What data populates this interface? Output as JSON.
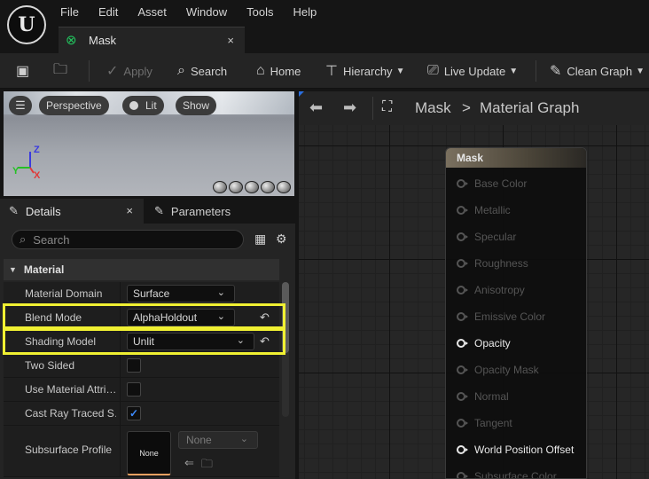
{
  "menu": [
    "File",
    "Edit",
    "Asset",
    "Window",
    "Tools",
    "Help"
  ],
  "tab": {
    "label": "Mask",
    "close": "×"
  },
  "toolbar": {
    "apply": "Apply",
    "search": "Search",
    "home": "Home",
    "hierarchy": "Hierarchy",
    "live_update": "Live Update",
    "clean_graph": "Clean Graph"
  },
  "viewport": {
    "perspective": "Perspective",
    "lit": "Lit",
    "show": "Show",
    "axis_z": "Z",
    "axis_y": "Y",
    "axis_x": "X"
  },
  "panel_tabs": {
    "details": "Details",
    "details_close": "×",
    "parameters": "Parameters"
  },
  "details": {
    "search_placeholder": "Search",
    "section": "Material",
    "rows": {
      "material_domain": {
        "label": "Material Domain",
        "value": "Surface"
      },
      "blend_mode": {
        "label": "Blend Mode",
        "value": "AlphaHoldout"
      },
      "shading_model": {
        "label": "Shading Model",
        "value": "Unlit"
      },
      "two_sided": {
        "label": "Two Sided",
        "checked": false
      },
      "use_material_attributes": {
        "label": "Use Material Attri…",
        "checked": false
      },
      "cast_ray_traced": {
        "label": "Cast Ray Traced S…",
        "checked": true
      },
      "subsurface_profile": {
        "label": "Subsurface Profile",
        "thumb": "None",
        "value": "None"
      }
    }
  },
  "graph": {
    "breadcrumb_root": "Mask",
    "breadcrumb_sep": ">",
    "breadcrumb_current": "Material Graph",
    "node": {
      "title": "Mask",
      "pins": [
        {
          "label": "Base Color",
          "active": false
        },
        {
          "label": "Metallic",
          "active": false
        },
        {
          "label": "Specular",
          "active": false
        },
        {
          "label": "Roughness",
          "active": false
        },
        {
          "label": "Anisotropy",
          "active": false
        },
        {
          "label": "Emissive Color",
          "active": false
        },
        {
          "label": "Opacity",
          "active": true
        },
        {
          "label": "Opacity Mask",
          "active": false
        },
        {
          "label": "Normal",
          "active": false
        },
        {
          "label": "Tangent",
          "active": false
        },
        {
          "label": "World Position Offset",
          "active": true
        },
        {
          "label": "Subsurface Color",
          "active": false
        }
      ]
    }
  },
  "colors": {
    "highlight": "#f0f032",
    "checkbox_check": "#3d8cff",
    "tab_icon": "#22c55e",
    "graph_corner": "#2b6fe0"
  }
}
